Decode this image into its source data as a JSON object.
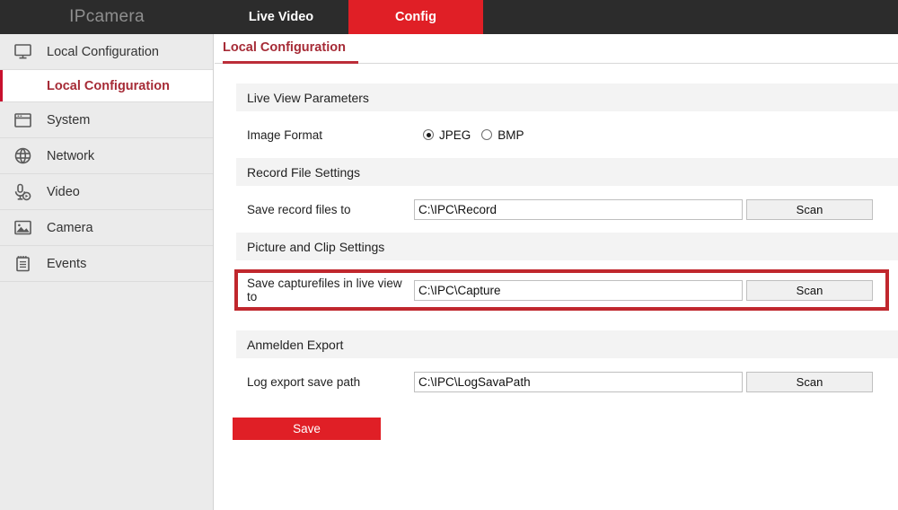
{
  "topbar": {
    "brand": "IPcamera",
    "nav": [
      {
        "label": "Live Video",
        "active": false
      },
      {
        "label": "Config",
        "active": true
      }
    ]
  },
  "sidebar": {
    "items": [
      {
        "label": "Local Configuration",
        "icon": "monitor-icon"
      },
      {
        "label": "System",
        "icon": "window-icon"
      },
      {
        "label": "Network",
        "icon": "globe-icon"
      },
      {
        "label": "Video",
        "icon": "microphone-play-icon"
      },
      {
        "label": "Camera",
        "icon": "picture-icon"
      },
      {
        "label": "Events",
        "icon": "clipboard-icon"
      }
    ],
    "active_sub_item": "Local Configuration"
  },
  "content": {
    "tab": "Local Configuration",
    "sections": {
      "live_view": {
        "title": "Live View Parameters",
        "image_format": {
          "label": "Image Format",
          "options": [
            {
              "label": "JPEG",
              "selected": true
            },
            {
              "label": "BMP",
              "selected": false
            }
          ]
        }
      },
      "record_file": {
        "title": "Record File Settings",
        "save_record_label": "Save record files to",
        "save_record_value": "C:\\IPC\\Record",
        "scan_label": "Scan"
      },
      "picture_clip": {
        "title": "Picture and Clip Settings",
        "save_capture_label": "Save capturefiles in live view to",
        "save_capture_value": "C:\\IPC\\Capture",
        "scan_label": "Scan",
        "highlighted": true,
        "highlight_color": "#c0272d"
      },
      "log_export": {
        "title": "Anmelden Export",
        "log_path_label": "Log export save path",
        "log_path_value": "C:\\IPC\\LogSavaPath",
        "scan_label": "Scan"
      }
    },
    "save_label": "Save"
  },
  "colors": {
    "brand_red": "#e01f26",
    "accent_red": "#a62b36",
    "topbar_bg": "#2c2c2c",
    "sidebar_bg": "#ebebeb",
    "section_bg": "#f3f3f3"
  }
}
